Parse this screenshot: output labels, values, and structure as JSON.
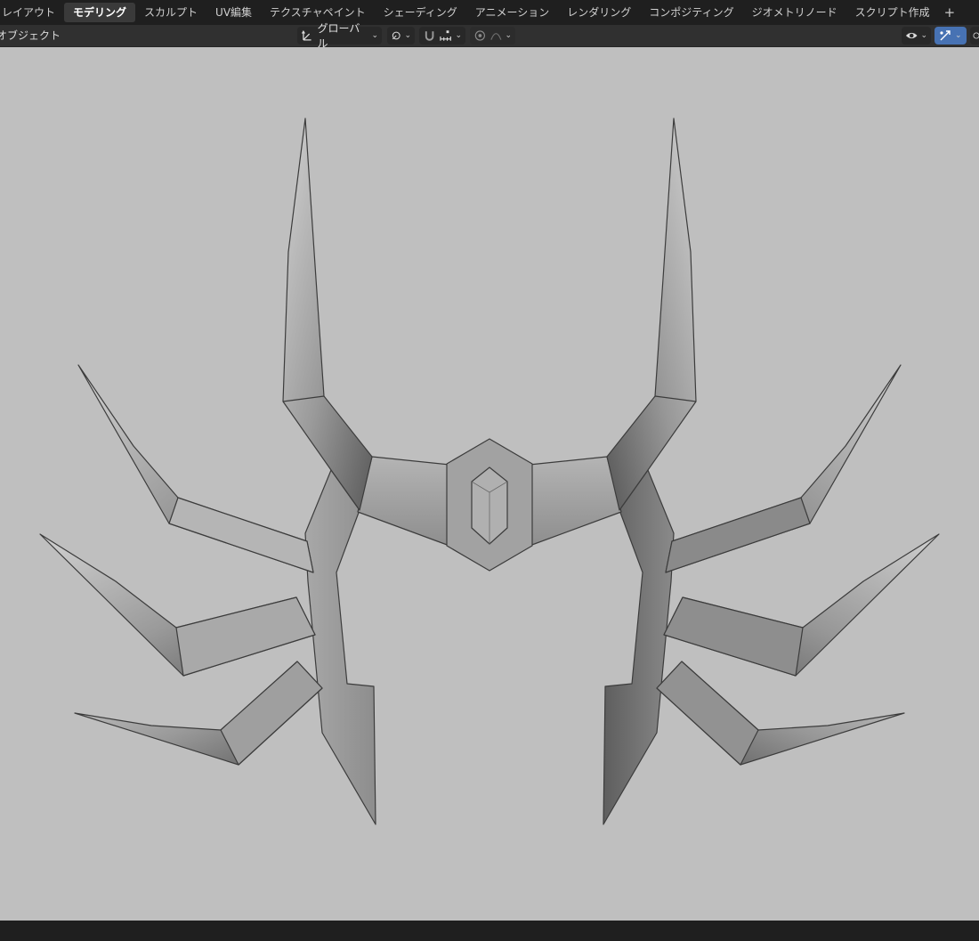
{
  "topbar": {
    "tabs": [
      {
        "label": "レイアウト",
        "active": false
      },
      {
        "label": "モデリング",
        "active": true
      },
      {
        "label": "スカルプト",
        "active": false
      },
      {
        "label": "UV編集",
        "active": false
      },
      {
        "label": "テクスチャペイント",
        "active": false
      },
      {
        "label": "シェーディング",
        "active": false
      },
      {
        "label": "アニメーション",
        "active": false
      },
      {
        "label": "レンダリング",
        "active": false
      },
      {
        "label": "コンポジティング",
        "active": false
      },
      {
        "label": "ジオメトリノード",
        "active": false
      },
      {
        "label": "スクリプト作成",
        "active": false
      }
    ],
    "add_tab_label": "+"
  },
  "header": {
    "mode_label": "オブジェクト",
    "orientation_label": "グローバル",
    "pivot_icon": "pivot-icon",
    "snap_icon": "magnet-icon",
    "proportional_icon": "proportional-icon"
  },
  "viewport": {
    "background": "#bfbfbf",
    "model_color": "#9a9a9a",
    "model_edge": "#3c3c3c",
    "model_subject": "spiked horn crown / wing ornament mesh"
  }
}
